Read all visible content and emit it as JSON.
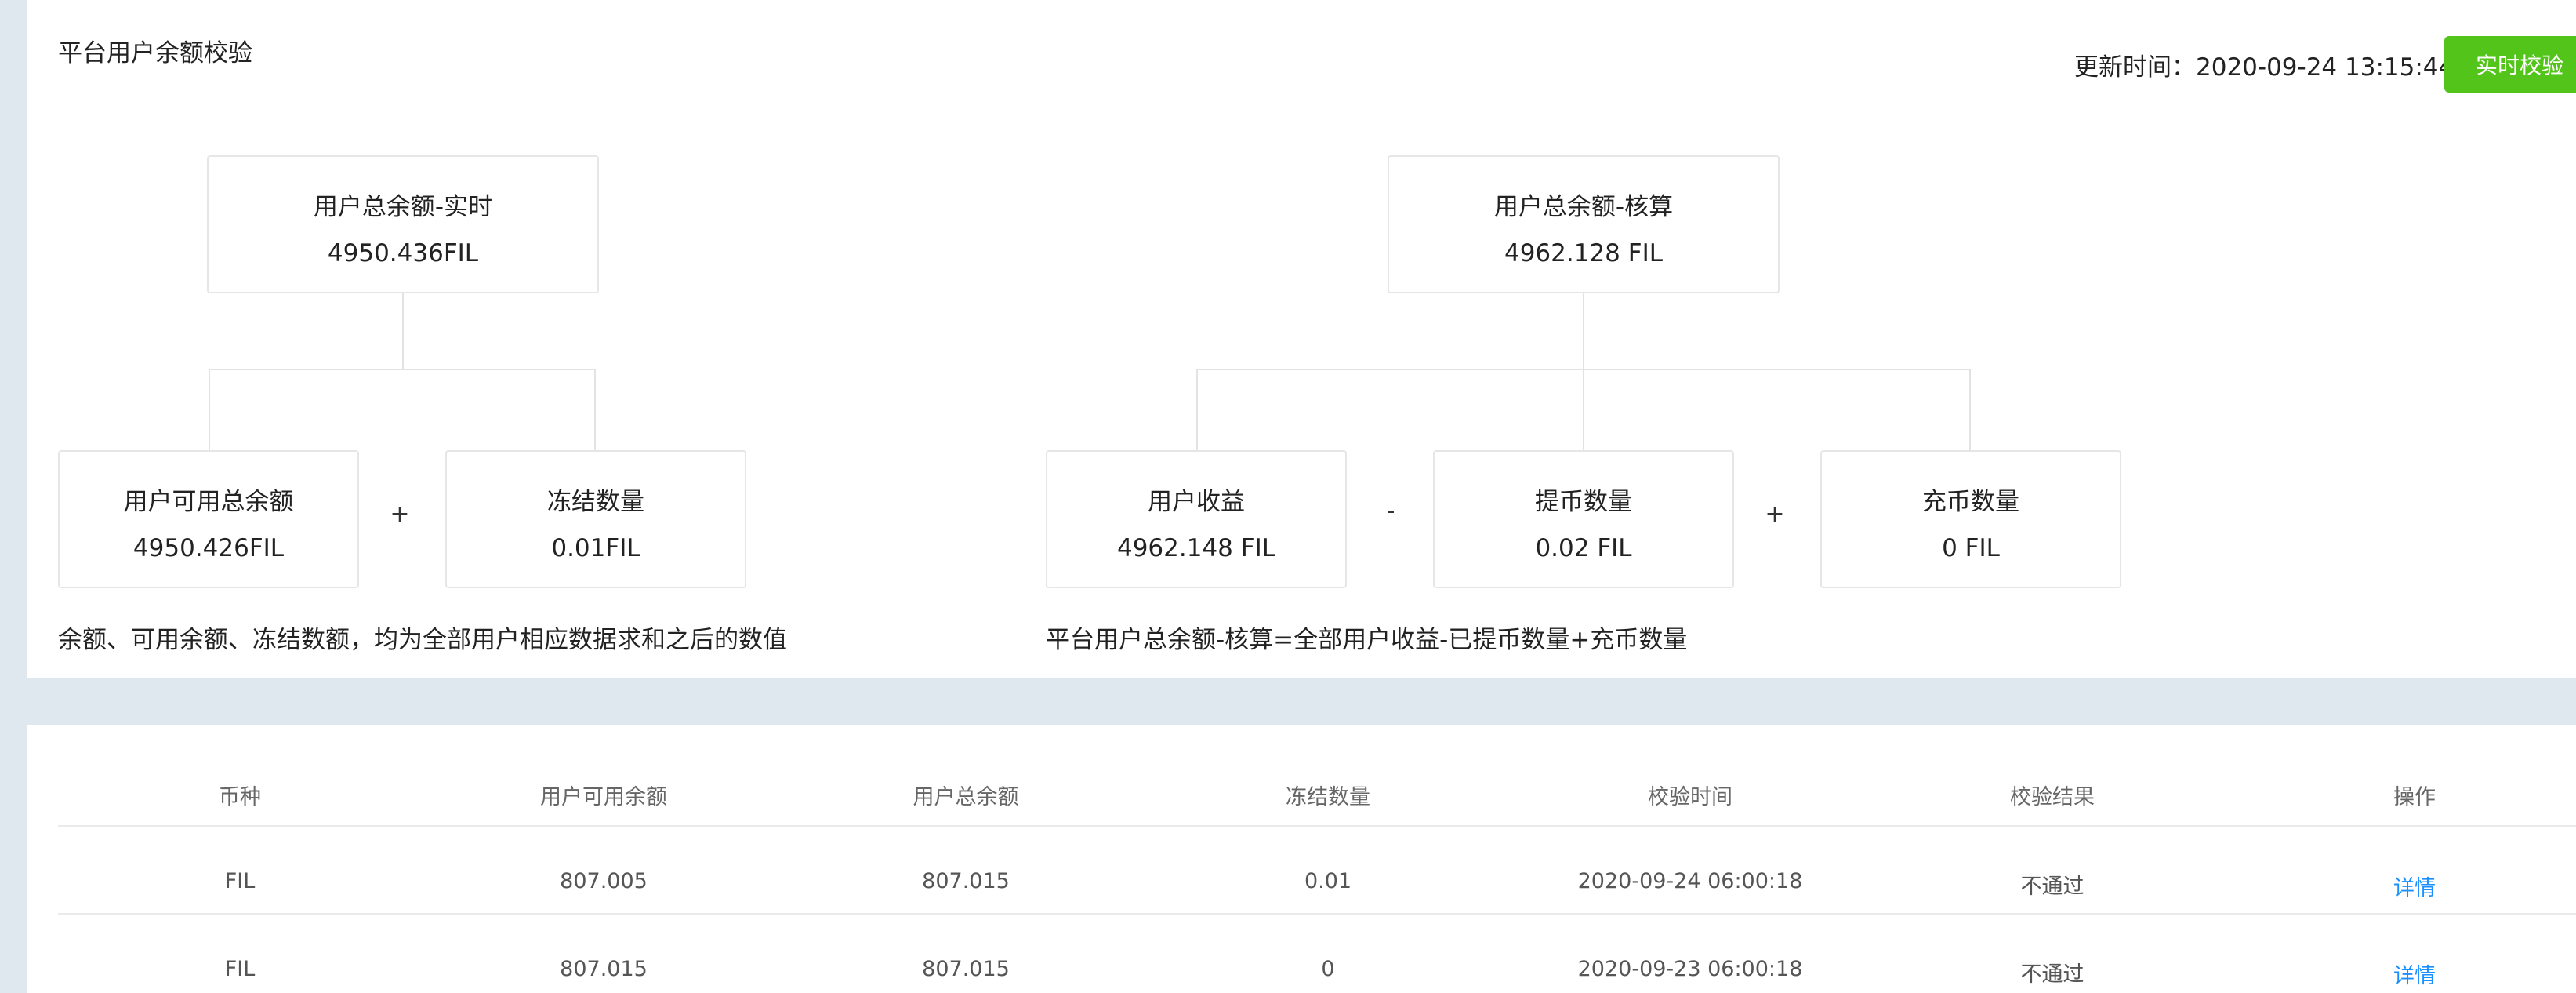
{
  "header": {
    "title": "平台用户余额校验",
    "update_label": "更新时间：",
    "update_time": "2020-09-24 13:15:44",
    "verify_button": "实时校验"
  },
  "realtime": {
    "total": {
      "label": "用户总余额-实时",
      "value": "4950.436FIL"
    },
    "available": {
      "label": "用户可用总余额",
      "value": "4950.426FIL"
    },
    "frozen": {
      "label": "冻结数量",
      "value": "0.01FIL"
    },
    "op_plus": "+",
    "note": "余额、可用余额、冻结数额，均为全部用户相应数据求和之后的数值"
  },
  "accounting": {
    "total": {
      "label": "用户总余额-核算",
      "value": "4962.128 FIL"
    },
    "income": {
      "label": "用户收益",
      "value": "4962.148 FIL"
    },
    "withdraw": {
      "label": "提币数量",
      "value": "0.02 FIL"
    },
    "deposit": {
      "label": "充币数量",
      "value": "0 FIL"
    },
    "op_minus": "-",
    "op_plus": "+",
    "note": "平台用户总余额-核算=全部用户收益-已提币数量+充币数量"
  },
  "table": {
    "columns": [
      "币种",
      "用户可用余额",
      "用户总余额",
      "冻结数量",
      "校验时间",
      "校验结果",
      "操作"
    ],
    "rows": [
      {
        "coin": "FIL",
        "available": "807.005",
        "total": "807.015",
        "frozen": "0.01",
        "time": "2020-09-24 06:00:18",
        "result": "不通过",
        "action": "详情"
      },
      {
        "coin": "FIL",
        "available": "807.015",
        "total": "807.015",
        "frozen": "0",
        "time": "2020-09-23 06:00:18",
        "result": "不通过",
        "action": "详情"
      }
    ]
  },
  "colors": {
    "accent_green": "#52c41a",
    "link_blue": "#1890ff",
    "page_background": "#dfe8ef"
  }
}
